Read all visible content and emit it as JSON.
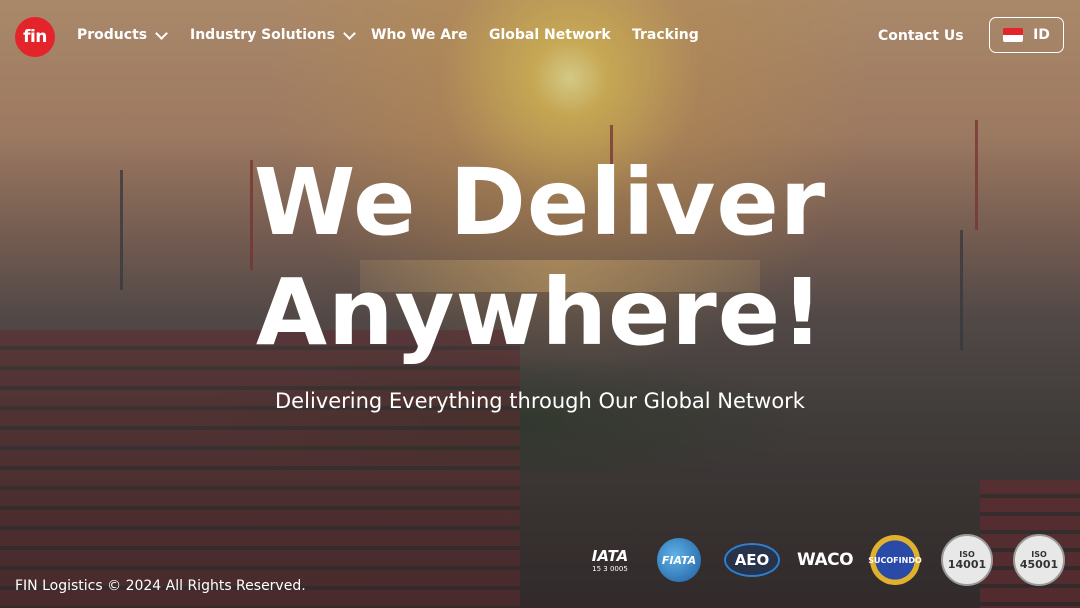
{
  "nav": {
    "logo_text": "fin",
    "items": [
      {
        "label": "Products",
        "has_dropdown": true
      },
      {
        "label": "Industry Solutions",
        "has_dropdown": true
      },
      {
        "label": "Who We Are",
        "has_dropdown": false
      },
      {
        "label": "Global Network",
        "has_dropdown": false
      },
      {
        "label": "Tracking",
        "has_dropdown": false
      }
    ],
    "contact_label": "Contact Us",
    "language": "ID"
  },
  "hero": {
    "title_line1": "We Deliver",
    "title_line2": "Anywhere!",
    "subtitle": "Delivering Everything through Our Global Network"
  },
  "footer": {
    "copyright": "FIN Logistics © 2024 All Rights Reserved."
  },
  "certifications": [
    {
      "name": "iata-logo",
      "text": "IATA",
      "subtext": "15 3 0005"
    },
    {
      "name": "fiata-logo",
      "text": "FIATA"
    },
    {
      "name": "aeo-logo",
      "text": "AEO"
    },
    {
      "name": "waco-logo",
      "text": "WACO"
    },
    {
      "name": "sucofindo-logo",
      "text": "SUCOFINDO"
    },
    {
      "name": "iso-14001-logo",
      "text": "ISO",
      "subtext": "14001"
    },
    {
      "name": "iso-45001-logo",
      "text": "ISO",
      "subtext": "45001"
    }
  ],
  "colors": {
    "brand_red": "#e3242b",
    "flag_red": "#e3242b",
    "flag_white": "#ffffff"
  }
}
